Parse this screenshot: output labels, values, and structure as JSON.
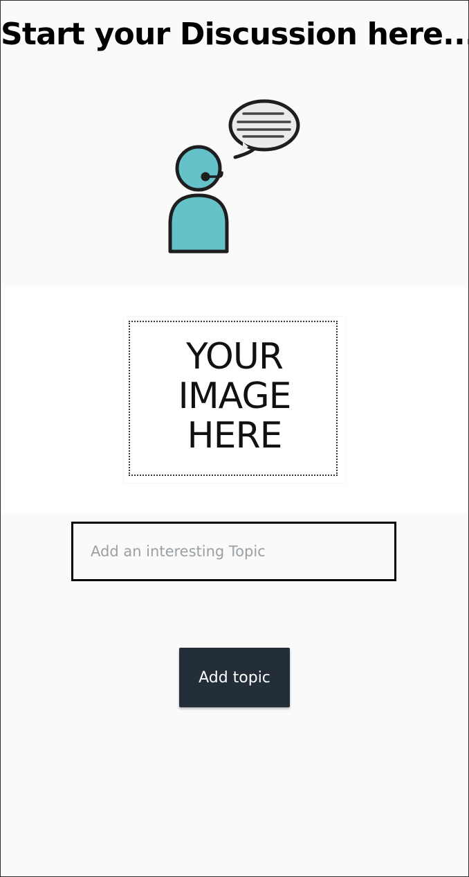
{
  "header": {
    "title": "Start your Discussion here...."
  },
  "illustration": {
    "icon": "discussion-person-speech-bubble",
    "accent_color": "#65c2c9"
  },
  "image_upload": {
    "icon": "image-placeholder",
    "lines": [
      "YOUR",
      "IMAGE",
      "HERE"
    ]
  },
  "topic_form": {
    "placeholder": "Add an interesting Topic",
    "value": "",
    "submit_label": "Add topic",
    "button_color": "#232e38"
  }
}
